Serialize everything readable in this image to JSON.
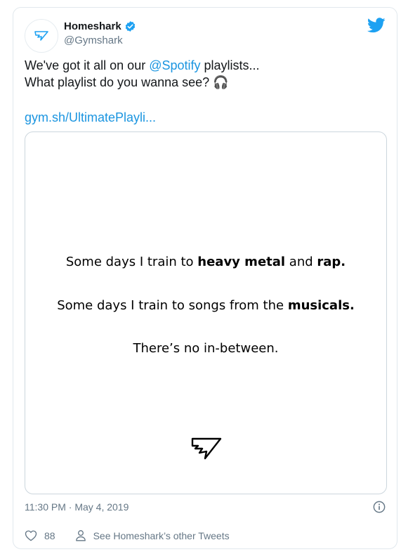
{
  "user": {
    "display_name": "Homeshark",
    "handle": "@Gymshark",
    "verified_icon": "verified-badge-icon",
    "avatar_icon": "gymshark-logo-icon"
  },
  "tweet": {
    "text_prefix": "We've got it all on our ",
    "mention": "@Spotify",
    "text_suffix": " playlists...",
    "line2": "What playlist do you wanna see? ",
    "emoji": "🎧",
    "link": "gym.sh/UltimatePlayli..."
  },
  "media": {
    "line1_a": "Some days I train to ",
    "line1_b": "heavy metal",
    "line1_c": " and ",
    "line1_d": "rap.",
    "line2_a": "Some days I train to songs from the ",
    "line2_b": "musicals.",
    "line3": "There’s no in-between.",
    "logo_icon": "gymshark-logo-icon"
  },
  "meta": {
    "timestamp": "11:30 PM · May 4, 2019",
    "info_icon": "info-icon"
  },
  "actions": {
    "likes": "88",
    "see_more": "See Homeshark’s other Tweets"
  },
  "colors": {
    "link_blue": "#1b95e0",
    "twitter_blue": "#1da1f2",
    "secondary_text": "#657786",
    "border": "#e1e8ed"
  }
}
